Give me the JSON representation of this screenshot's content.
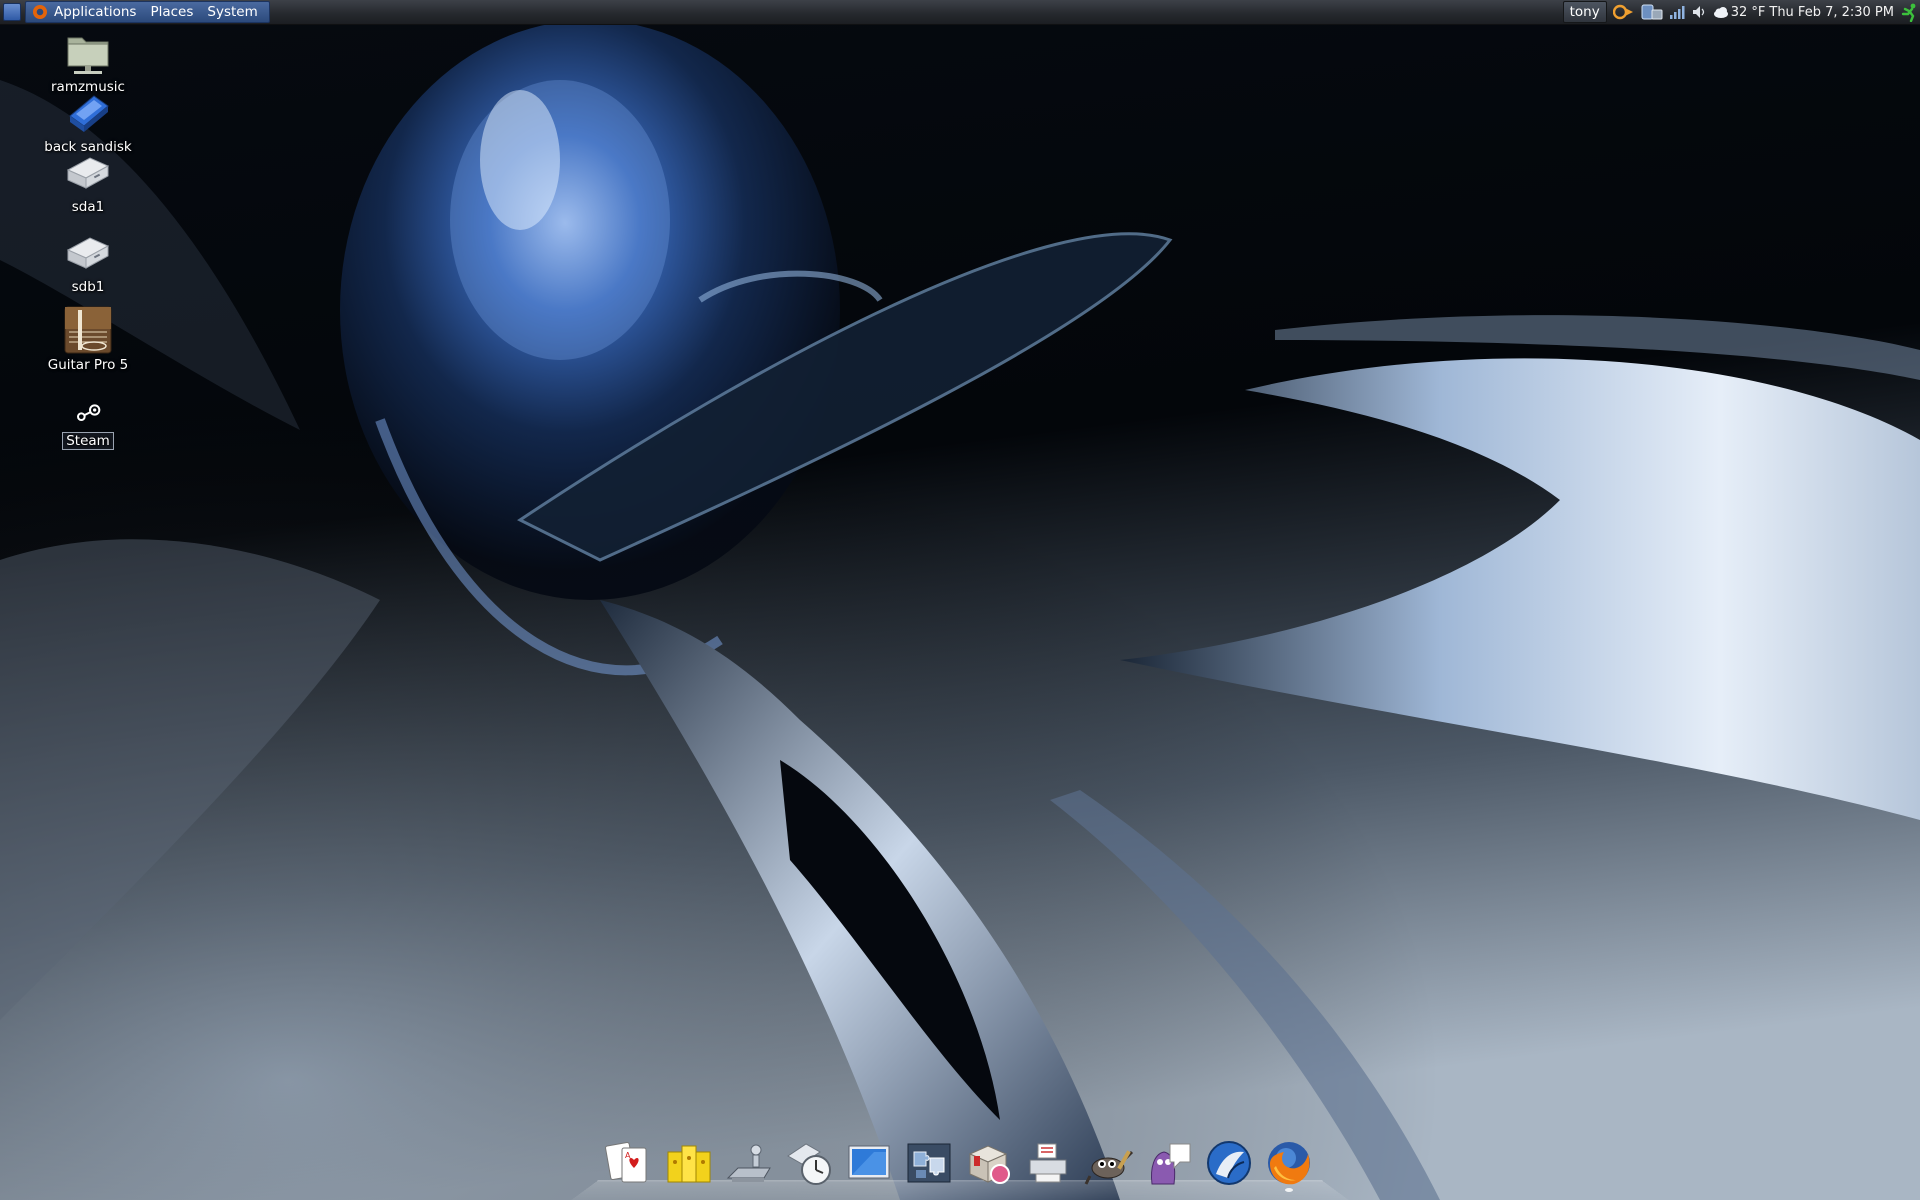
{
  "top_panel": {
    "menus": {
      "applications": "Applications",
      "places": "Places",
      "system": "System"
    },
    "user": "tony",
    "weather": "32 °F",
    "clock": "Thu Feb  7,  2:30 PM",
    "tray_icons": [
      "update-manager-icon",
      "storage-applet-icon",
      "network-signal-icon",
      "volume-icon",
      "weather-cloud-icon",
      "quit-runner-icon"
    ]
  },
  "desktop": {
    "icons": [
      {
        "label": "ramzmusic",
        "icon": "network-folder-icon"
      },
      {
        "label": "back sandisk",
        "icon": "usb-drive-icon"
      },
      {
        "label": "sda1",
        "icon": "hard-drive-icon"
      },
      {
        "label": "sdb1",
        "icon": "hard-drive-icon"
      },
      {
        "label": "Guitar Pro 5",
        "icon": "guitar-pro-icon"
      },
      {
        "label": "Steam",
        "icon": "steam-icon",
        "selected": true
      }
    ]
  },
  "dock": {
    "items": [
      {
        "name": "solitaire-cards-icon",
        "running": false
      },
      {
        "name": "mahjongg-tiles-icon",
        "running": false
      },
      {
        "name": "remote-desktop-icon",
        "running": false
      },
      {
        "name": "clock-mail-icon",
        "running": false
      },
      {
        "name": "screen-desktop-icon",
        "running": false
      },
      {
        "name": "puzzle-icon",
        "running": false
      },
      {
        "name": "software-package-icon",
        "running": false
      },
      {
        "name": "printer-scanner-icon",
        "running": false
      },
      {
        "name": "gimp-icon",
        "running": false
      },
      {
        "name": "pidgin-chat-icon",
        "running": false
      },
      {
        "name": "browser-globe-icon",
        "running": false
      },
      {
        "name": "firefox-icon",
        "running": true
      }
    ]
  }
}
